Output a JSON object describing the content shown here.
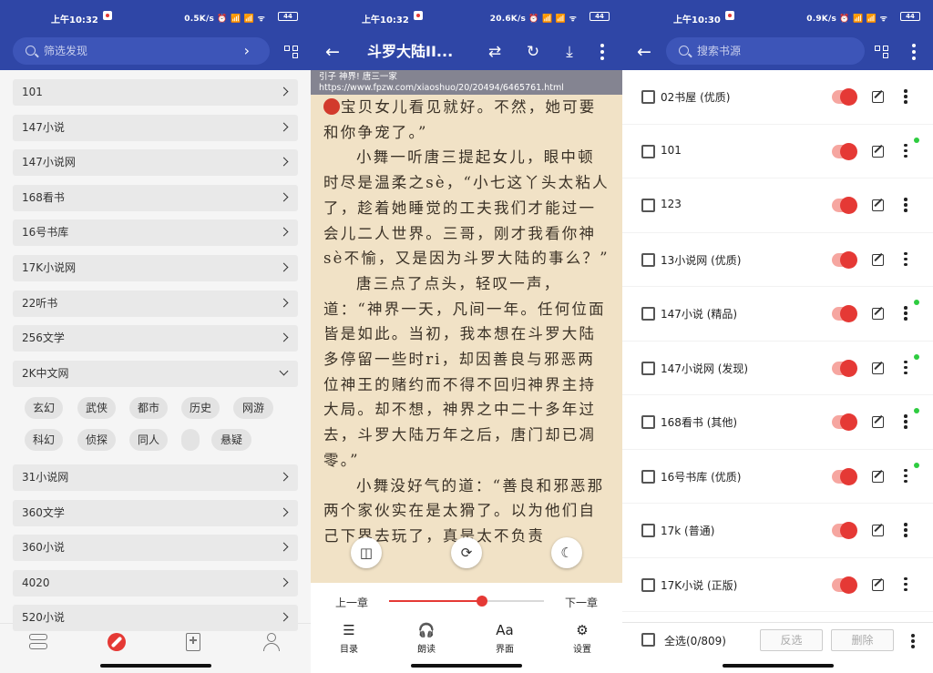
{
  "panel1": {
    "status": {
      "time": "上午10:32",
      "net": "0.5K/s ⏰ 📶 📶 ᯤ",
      "battery": "44"
    },
    "search_placeholder": "筛选发现",
    "groups_top": [
      "101",
      "147小说",
      "147小说网",
      "168看书",
      "16号书库",
      "17K小说网",
      "22听书",
      "256文学"
    ],
    "open_group": "2K中文网",
    "chips_row1": [
      "玄幻",
      "武侠",
      "都市",
      "历史",
      "网游"
    ],
    "chips_row2": [
      "科幻",
      "侦探",
      "同人",
      "",
      "悬疑"
    ],
    "groups_bottom": [
      "31小说网",
      "360文学",
      "360小说",
      "4020",
      "520小说"
    ],
    "nav_icons": [
      "bookshelf-icon",
      "discover-icon",
      "rss-icon",
      "profile-icon"
    ]
  },
  "panel2": {
    "status": {
      "time": "上午10:32",
      "net": "20.6K/s ⏰ 📶 📶 ᯤ",
      "battery": "44"
    },
    "title": "斗罗大陆II...",
    "source_line1": "引子 神界! 唐三一家",
    "source_line2": "https://www.fpzw.com/xiaoshuo/20/20494/6465761.html",
    "paragraphs": [
      {
        "indent": false,
        "mark": true,
        "text": "宝贝女儿看见就好。不然，她可要和你争宠了。”"
      },
      {
        "indent": true,
        "mark": false,
        "text": "小舞一听唐三提起女儿，眼中顿时尽是温柔之sè，“小七这丫头太粘人了，趁着她睡觉的工夫我们才能过一会儿二人世界。三哥，刚才我看你神sè不愉，又是因为斗罗大陆的事么？”"
      },
      {
        "indent": true,
        "mark": false,
        "text": "唐三点了点头，轻叹一声，道：“神界一天，凡间一年。任何位面皆是如此。当初，我本想在斗罗大陆多停留一些时ri，却因善良与邪恶两位神王的赌约而不得不回归神界主持大局。却不想，神界之中二十多年过去，斗罗大陆万年之后，唐门却已凋零。”"
      },
      {
        "indent": true,
        "mark": false,
        "text": "小舞没好气的道：“善良和邪恶那两个家伙实在是太猾了。以为他们自己下界去玩了，真是太不负责"
      }
    ],
    "prev_chapter": "上一章",
    "next_chapter": "下一章",
    "progress": 0.6,
    "tools": [
      {
        "icon": "☰",
        "label": "目录",
        "name": "toc-button"
      },
      {
        "icon": "🎧",
        "label": "朗读",
        "name": "read-aloud-button"
      },
      {
        "icon": "Aa",
        "label": "界面",
        "name": "interface-button"
      },
      {
        "icon": "⚙",
        "label": "设置",
        "name": "settings-button"
      }
    ]
  },
  "panel3": {
    "status": {
      "time": "上午10:30",
      "net": "0.9K/s ⏰ 📶 📶 ᯤ",
      "battery": "44"
    },
    "search_placeholder": "搜索书源",
    "sources": [
      {
        "label": "02书屋 (优质)",
        "dot": false
      },
      {
        "label": "101",
        "dot": true
      },
      {
        "label": "123",
        "dot": false
      },
      {
        "label": "13小说网 (优质)",
        "dot": false
      },
      {
        "label": "147小说 (精品)",
        "dot": true
      },
      {
        "label": "147小说网 (发现)",
        "dot": true
      },
      {
        "label": "168看书 (其他)",
        "dot": true
      },
      {
        "label": "16号书库 (优质)",
        "dot": true
      },
      {
        "label": "17k (普通)",
        "dot": false
      },
      {
        "label": "17K小说 (正版)",
        "dot": false
      }
    ],
    "select_all": "全选(0/809)",
    "invert_label": "反选",
    "delete_label": "删除"
  },
  "colors": {
    "primary": "#2f46a6",
    "accent": "#e53935",
    "paper": "#f1e2c6",
    "online_dot": "#2ecc40"
  }
}
